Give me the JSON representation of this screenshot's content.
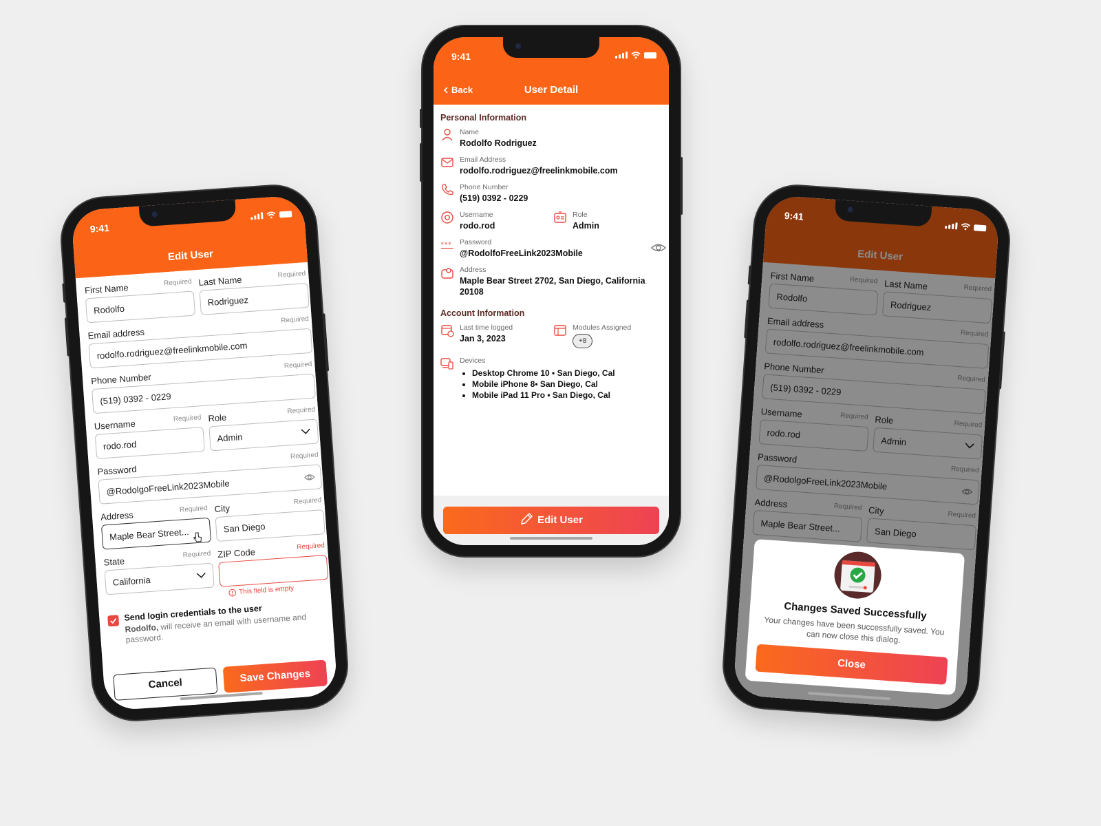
{
  "status_time": "9:41",
  "colors": {
    "accent": "#fb6416",
    "accent_end": "#ee4254",
    "error": "#e7473e",
    "background": "#efefef"
  },
  "edit_form": {
    "title": "Edit User",
    "first_name": {
      "label": "First Name",
      "required": "Required",
      "value": "Rodolfo"
    },
    "last_name": {
      "label": "Last Name",
      "required": "Required",
      "value": "Rodriguez"
    },
    "email": {
      "label": "Email address",
      "required": "Required",
      "value": "rodolfo.rodriguez@freelinkmobile.com"
    },
    "phone": {
      "label": "Phone Number",
      "required": "Required",
      "value": "(519) 0392 - 0229"
    },
    "username": {
      "label": "Username",
      "required": "Required",
      "value": "rodo.rod"
    },
    "role": {
      "label": "Role",
      "required": "Required",
      "value": "Admin"
    },
    "password": {
      "label": "Password",
      "required": "Required",
      "value": "@RodolgoFreeLink2023Mobile"
    },
    "address": {
      "label": "Address",
      "required": "Required",
      "value": "Maple Bear Street..."
    },
    "city": {
      "label": "City",
      "required": "Required",
      "value": "San Diego"
    },
    "state": {
      "label": "State",
      "required": "Required",
      "value": "California"
    },
    "zip": {
      "label": "ZIP Code",
      "required": "Required",
      "value": "",
      "error": "This field is empty"
    },
    "send_credentials": {
      "checked": true,
      "title": "Send login credentials to the user",
      "name": "Rodolfo,",
      "desc": "will receive an email with username and password."
    },
    "cancel_label": "Cancel",
    "save_label": "Save Changes"
  },
  "detail": {
    "back_label": "Back",
    "title": "User Detail",
    "personal_heading": "Personal Information",
    "name": {
      "label": "Name",
      "value": "Rodolfo Rodriguez"
    },
    "email": {
      "label": "Email Address",
      "value": "rodolfo.rodriguez@freelinkmobile.com"
    },
    "phone": {
      "label": "Phone Number",
      "value": "(519) 0392 - 0229"
    },
    "username": {
      "label": "Username",
      "value": "rodo.rod"
    },
    "role": {
      "label": "Role",
      "value": "Admin"
    },
    "password": {
      "label": "Password",
      "value": "@RodolfoFreeLink2023Mobile"
    },
    "address": {
      "label": "Address",
      "value_line1": "Maple Bear Street 2702, San Diego, California",
      "value_line2": "20108"
    },
    "account_heading": "Account Information",
    "last_logged": {
      "label": "Last time logged",
      "value": "Jan 3, 2023"
    },
    "modules": {
      "label": "Modules Assigned",
      "value": "+8"
    },
    "devices": {
      "label": "Devices",
      "items": [
        "Desktop Chrome 10 • San Diego, Cal",
        "Mobile iPhone 8• San Diego, Cal",
        "Mobile iPad 11 Pro • San Diego, Cal"
      ]
    },
    "edit_button": "Edit User"
  },
  "saved": {
    "title": "Edit User",
    "first_name": {
      "label": "First Name",
      "required": "Required",
      "value": "Rodolfo"
    },
    "last_name": {
      "label": "Last Name",
      "required": "Required",
      "value": "Rodriguez"
    },
    "email": {
      "label": "Email address",
      "required": "Required",
      "value": "rodolfo.rodriguez@freelinkmobile.com"
    },
    "phone": {
      "label": "Phone Number",
      "required": "Required",
      "value": "(519) 0392 - 0229"
    },
    "username": {
      "label": "Username",
      "required": "Required",
      "value": "rodo.rod"
    },
    "role": {
      "label": "Role",
      "required": "Required",
      "value": "Admin"
    },
    "password": {
      "label": "Password",
      "required": "Required",
      "value": "@RodolgoFreeLink2023Mobile"
    },
    "address": {
      "label": "Address",
      "required": "Required",
      "value": "Maple Bear Street..."
    },
    "city": {
      "label": "City",
      "required": "Required",
      "value": "San Diego"
    },
    "dialog": {
      "title": "Changes Saved Successfully",
      "message": "Your changes have been successfully saved. You can now close this dialog.",
      "close_label": "Close"
    }
  }
}
